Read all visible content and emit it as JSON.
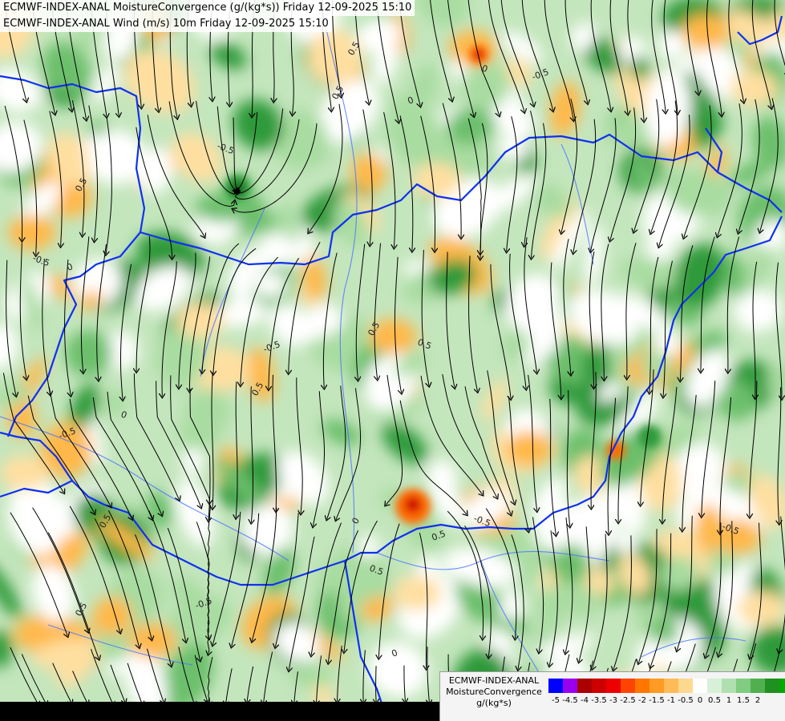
{
  "header": {
    "line1": "ECMWF-INDEX-ANAL MoistureConvergence (g/(kg*s)) Friday 12-09-2025 15:10",
    "line2": "ECMWF-INDEX-ANAL Wind (m/s) 10m Friday 12-09-2025 15:10"
  },
  "legend": {
    "title_line1": "ECMWF-INDEX-ANAL",
    "title_line2": "MoistureConvergence",
    "unit": "g/(kg*s)",
    "colors": [
      "#0000ff",
      "#9900ee",
      "#aa0000",
      "#cc0000",
      "#ee0000",
      "#ff4400",
      "#ff7700",
      "#ff9a22",
      "#ffbb55",
      "#ffd890",
      "#ffffff",
      "#d8f0d8",
      "#b0e0b0",
      "#80cc80",
      "#50b050",
      "#209020",
      "#00aa00"
    ],
    "ticks": [
      "-5",
      "-4.5",
      "-4",
      "-3.5",
      "-3",
      "-2.5",
      "-2",
      "-1.5",
      "-1",
      "-0.5",
      "0",
      "0.5",
      "1",
      "1.5",
      "2"
    ]
  },
  "map": {
    "field_colors": {
      "convergence_strong": "#2e9a3a",
      "convergence_medium": "#6cbf6c",
      "convergence_light": "#a8dca0",
      "neutral": "#ffffff",
      "divergence_light": "#ffdfa0",
      "divergence_medium": "#ffb84a",
      "divergence_strong": "#ff6a00",
      "divergence_extreme": "#cc0000",
      "convergence_extreme": "#0b4d10"
    },
    "border_color": "#1030f0",
    "river_color": "#4a70ff",
    "streamline_color": "#000000",
    "contour_labels": [
      "0.5",
      "0",
      "-0.5",
      "0.5",
      "-0.5",
      "0",
      "0.5",
      "-0.5",
      "0",
      "0.5",
      "0.5",
      "-0.5",
      "0.5",
      "0",
      "-0.5",
      "0.5",
      "-0.5",
      "0.5",
      "0",
      "0.5",
      "-0.5",
      "0.5",
      "-0.5",
      "0"
    ]
  }
}
